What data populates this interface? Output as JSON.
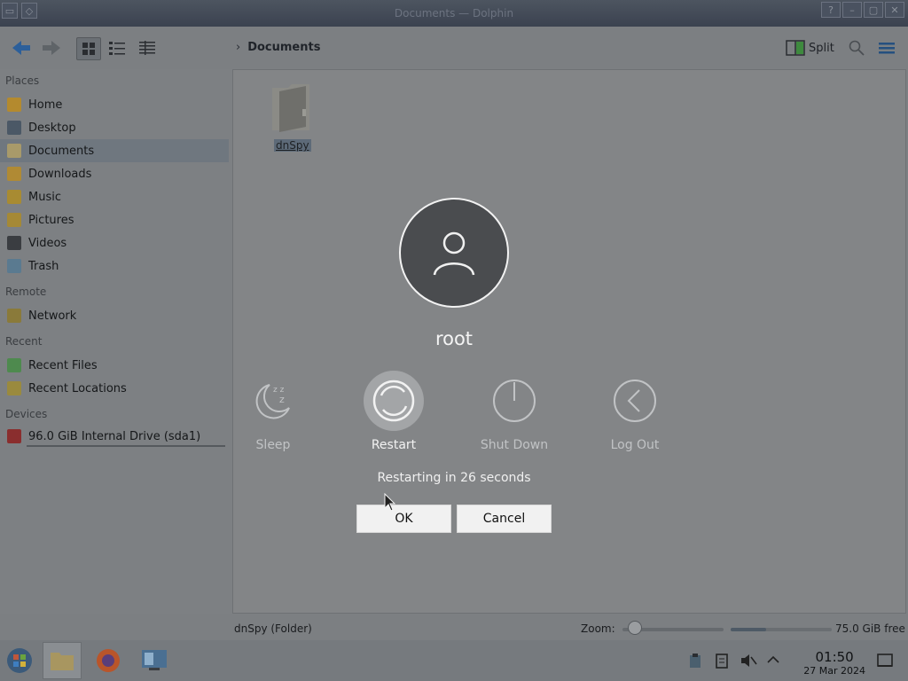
{
  "window": {
    "title": "Documents — Dolphin"
  },
  "toolbar": {
    "breadcrumb": "Documents",
    "split_label": "Split"
  },
  "sidebar": {
    "sections": {
      "places": "Places",
      "remote": "Remote",
      "recent": "Recent",
      "devices": "Devices"
    },
    "places": [
      {
        "label": "Home",
        "icon": "home-icon"
      },
      {
        "label": "Desktop",
        "icon": "desktop-icon"
      },
      {
        "label": "Documents",
        "icon": "documents-icon",
        "active": true
      },
      {
        "label": "Downloads",
        "icon": "downloads-icon"
      },
      {
        "label": "Music",
        "icon": "music-icon"
      },
      {
        "label": "Pictures",
        "icon": "pictures-icon"
      },
      {
        "label": "Videos",
        "icon": "videos-icon"
      },
      {
        "label": "Trash",
        "icon": "trash-icon"
      }
    ],
    "remote": [
      {
        "label": "Network",
        "icon": "network-icon"
      }
    ],
    "recent": [
      {
        "label": "Recent Files",
        "icon": "recent-files-icon"
      },
      {
        "label": "Recent Locations",
        "icon": "recent-locations-icon"
      }
    ],
    "devices": [
      {
        "label": "96.0 GiB Internal Drive (sda1)",
        "icon": "drive-icon"
      }
    ]
  },
  "main": {
    "folder_name": "dnSpy"
  },
  "statusbar": {
    "selection": "dnSpy (Folder)",
    "zoom_label": "Zoom:",
    "zoom_level": 0.12,
    "disk_used": 0.35,
    "free_space": "75.0 GiB free"
  },
  "taskbar": {
    "clock_time": "01:50",
    "clock_date": "27 Mar 2024"
  },
  "logout_dialog": {
    "username": "root",
    "actions": [
      {
        "label": "Sleep",
        "icon": "sleep-icon"
      },
      {
        "label": "Restart",
        "icon": "restart-icon",
        "selected": true
      },
      {
        "label": "Shut Down",
        "icon": "power-icon"
      },
      {
        "label": "Log Out",
        "icon": "logout-icon"
      }
    ],
    "countdown": "Restarting in 26 seconds",
    "ok_label": "OK",
    "cancel_label": "Cancel"
  },
  "colors": {
    "dim_overlay": "#7d8083",
    "dialog_text": "#f4f4f4",
    "selection": "#5d6a78"
  }
}
